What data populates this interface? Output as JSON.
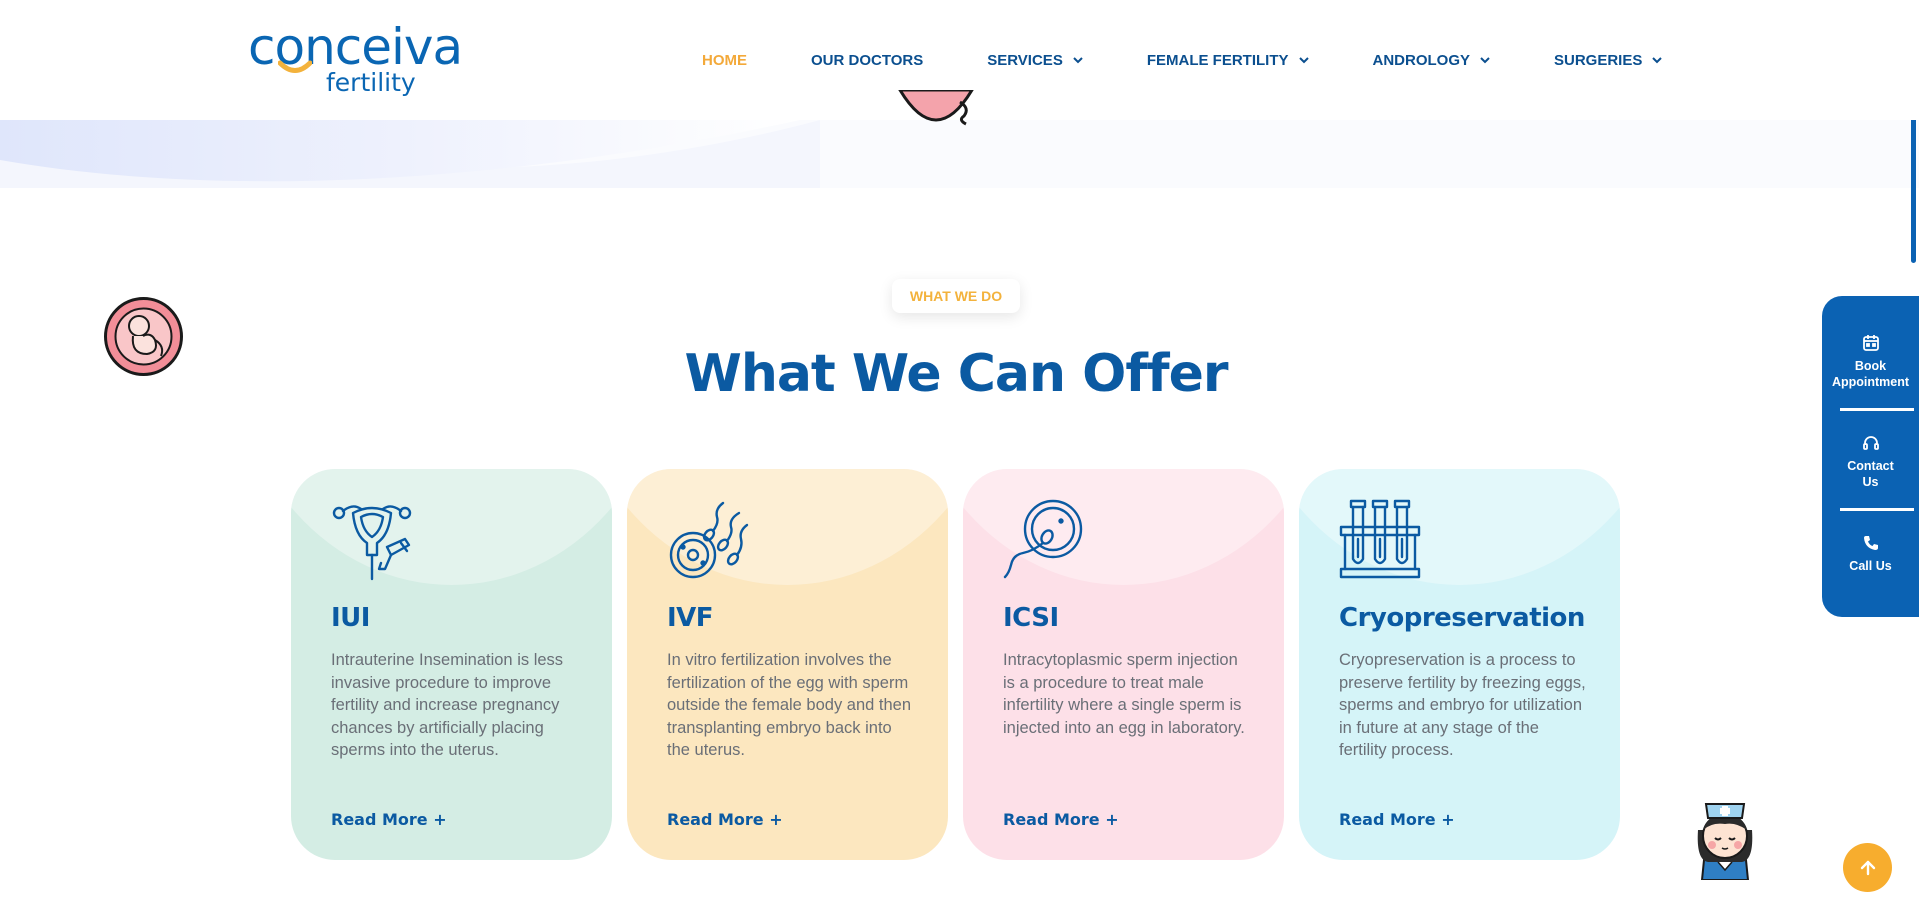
{
  "brand": {
    "name": "conceiva",
    "tagline": "fertility",
    "primary_color": "#0b5aa2",
    "accent_color": "#f3a93a"
  },
  "nav": {
    "items": [
      {
        "label": "HOME",
        "active": true,
        "dropdown": false
      },
      {
        "label": "OUR DOCTORS",
        "active": false,
        "dropdown": false
      },
      {
        "label": "SERVICES",
        "active": false,
        "dropdown": true
      },
      {
        "label": "FEMALE FERTILITY",
        "active": false,
        "dropdown": true
      },
      {
        "label": "ANDROLOGY",
        "active": false,
        "dropdown": true
      },
      {
        "label": "SURGERIES",
        "active": false,
        "dropdown": true
      }
    ]
  },
  "section": {
    "eyebrow": "WHAT WE DO",
    "title": "What We Can Offer"
  },
  "cards": [
    {
      "title": "IUI",
      "icon": "uterus-icon",
      "description": "Intrauterine Insemination is less invasive procedure to improve fertility and increase pregnancy chances by artificially placing sperms into the uterus.",
      "link": "Read More +",
      "color": "#d4ede4"
    },
    {
      "title": "IVF",
      "icon": "egg-sperm-icon",
      "description": "In vitro fertilization involves the fertilization of the egg with sperm outside the female body and then transplanting embryo back into the uterus.",
      "link": "Read More +",
      "color": "#fce7bf"
    },
    {
      "title": "ICSI",
      "icon": "sperm-injection-icon",
      "description": "Intracytoplasmic sperm injection is a procedure to treat male infertility where a single sperm is injected into an egg in laboratory.",
      "link": "Read More +",
      "color": "#fde0e8"
    },
    {
      "title": "Cryopreservation",
      "icon": "test-tubes-icon",
      "description": "Cryopreservation is a process to preserve fertility by freezing eggs, sperms and embryo for utilization in future at any stage of the fertility process.",
      "link": "Read More +",
      "color": "#d5f4f8"
    }
  ],
  "side_panel": {
    "book": "Book Appointment",
    "contact": "Contact Us",
    "call": "Call Us"
  }
}
